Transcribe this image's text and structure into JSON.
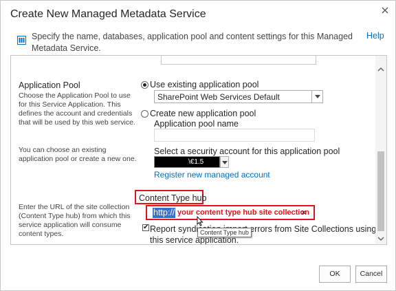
{
  "dialog": {
    "title": "Create New Managed Metadata Service",
    "intro": "Specify the name, databases, application pool and content settings for this Managed Metadata Service.",
    "help_label": "Help"
  },
  "app_pool": {
    "heading": "Application Pool",
    "description": "Choose the Application Pool to use for this Service Application.  This defines the account and credentials that will be used by this web service.",
    "description2": "You can choose an existing application pool or create a new one.",
    "use_existing_label": "Use existing application pool",
    "selected_pool": "SharePoint Web Services Default",
    "create_new_label": "Create new application pool",
    "pool_name_label": "Application pool name",
    "pool_name_value": "",
    "security_account_label": "Select a security account for this application pool",
    "account_value": "\\€1.5",
    "register_link": "Register new managed account"
  },
  "content_type_hub": {
    "heading": "Content Type hub",
    "description": "Enter the URL of the site collection (Content Type hub) from which this service application will consume content types.",
    "url_prefix": "http://",
    "url_hint": "your content type hub site collection",
    "clear_icon": "×",
    "report_label": "Report syndication import errors from Site Collections using this service application.",
    "report_checked": true,
    "check_mark": "✔",
    "tooltip": "Content Type hub"
  },
  "buttons": {
    "ok": "OK",
    "cancel": "Cancel"
  },
  "colors": {
    "accent": "#0072c6",
    "highlight_red": "#e3111a"
  }
}
